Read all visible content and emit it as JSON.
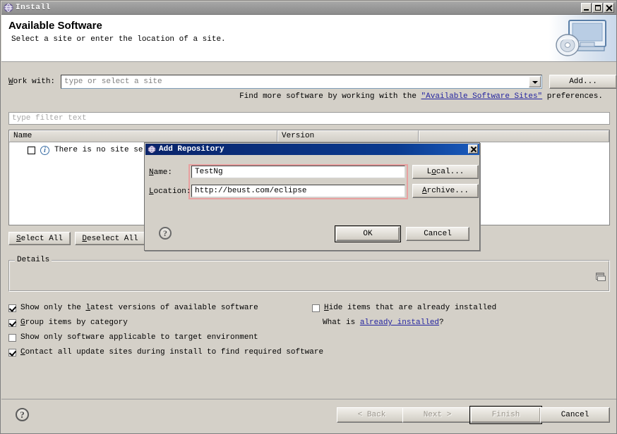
{
  "window": {
    "title": "Install",
    "icon": "eclipse-globe-icon",
    "controls": {
      "minimize": "minimize-button",
      "maximize": "maximize-button",
      "close": "close-button"
    }
  },
  "banner": {
    "title": "Available Software",
    "subtitle": "Select a site or enter the location of a site.",
    "art": "install-computer-cd-icon"
  },
  "work_with": {
    "label": "Work with:",
    "value": "",
    "placeholder": "type or select a site",
    "add_button": "Add..."
  },
  "find_more": {
    "prefix": "Find more software by working with the ",
    "link": "\"Available Software Sites\"",
    "suffix": " preferences."
  },
  "filter": {
    "placeholder": "type filter text",
    "value": ""
  },
  "table": {
    "columns": [
      "Name",
      "Version"
    ],
    "rows": [
      {
        "checked": false,
        "icon": "info-icon",
        "label": "There is no site selected."
      }
    ]
  },
  "list_buttons": {
    "select_all": "Select All",
    "deselect_all": "Deselect All"
  },
  "details": {
    "legend": "Details",
    "content": "",
    "expand_icon": "restore-details-icon"
  },
  "options_left": [
    {
      "label": "Show only the latest versions of available software",
      "checked": true,
      "mnemonic": "l"
    },
    {
      "label": "Group items by category",
      "checked": true,
      "mnemonic": "G"
    },
    {
      "label": "Show only software applicable to target environment",
      "checked": false,
      "mnemonic": ""
    },
    {
      "label": "Contact all update sites during install to find required software",
      "checked": true,
      "mnemonic": "C"
    }
  ],
  "options_right": {
    "hide_installed": {
      "label": "Hide items that are already installed",
      "checked": false
    },
    "what_is_prefix": "What is ",
    "what_is_link": "already installed",
    "what_is_suffix": "?"
  },
  "wizard_buttons": {
    "back": "< Back",
    "next": "Next >",
    "finish": "Finish",
    "cancel": "Cancel",
    "back_enabled": false,
    "next_enabled": false,
    "finish_enabled": false,
    "cancel_enabled": true,
    "help": "?"
  },
  "dialog": {
    "title": "Add Repository",
    "icon": "eclipse-globe-icon",
    "close": "close-button",
    "name_label": "Name:",
    "name_value": "TestNg",
    "location_label": "Location:",
    "location_value": "http://beust.com/eclipse",
    "local_button": "Local...",
    "archive_button": "Archive...",
    "ok_button": "OK",
    "cancel_button": "Cancel",
    "help": "?",
    "highlight_color": "#e8a0a0"
  },
  "colors": {
    "face": "#d4d0c8",
    "titlebar": "#9a9a9a",
    "dialog_titlebar": "#0a246a",
    "link": "#2424a0",
    "field_bg": "#ffffff"
  }
}
